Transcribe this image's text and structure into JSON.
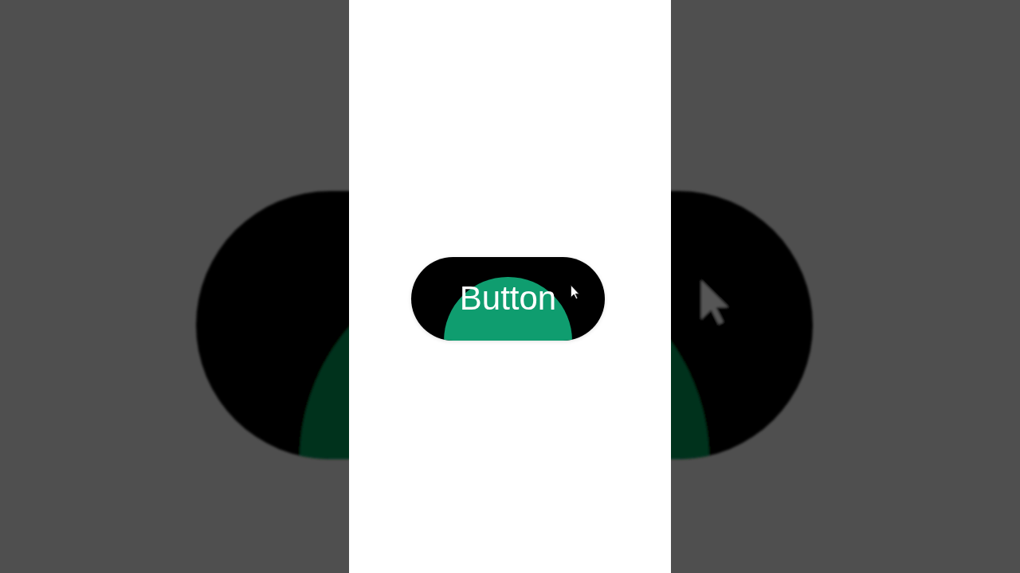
{
  "button": {
    "label": "Button",
    "hovered": true
  }
}
